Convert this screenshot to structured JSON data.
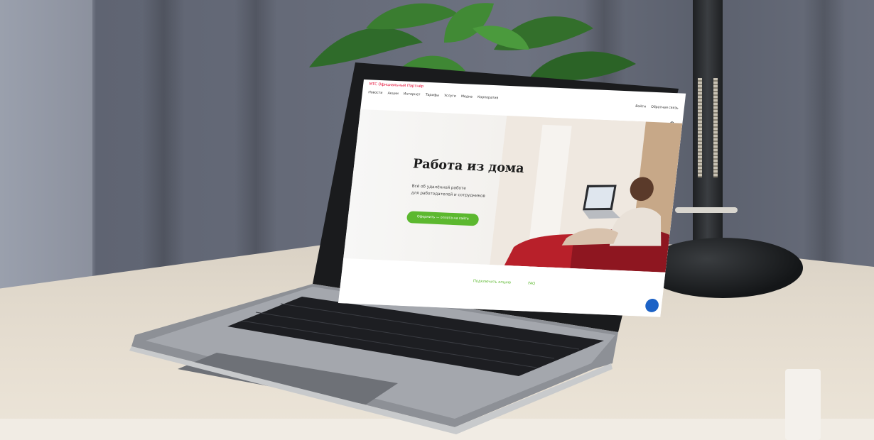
{
  "site": {
    "brand": "МТС Официальный Партнёр",
    "nav": [
      "Новости",
      "Акции",
      "Интернет",
      "Тарифы",
      "Услуги",
      "Медиа",
      "Корпоратив"
    ],
    "nav_right": [
      "Войти",
      "Обратная связь"
    ],
    "hero": {
      "title": "Работа из дома",
      "subtitle_line1": "Всё об удалённой работе",
      "subtitle_line2": "для работодателей и сотрудников",
      "cta_label": "Оформить — оплата на сайте"
    },
    "footer_links": [
      "Подключить опцию",
      "FAQ"
    ]
  },
  "colors": {
    "accent_green": "#5cb82f",
    "brand_red": "#e4002b",
    "chat_blue": "#1c62c6"
  }
}
